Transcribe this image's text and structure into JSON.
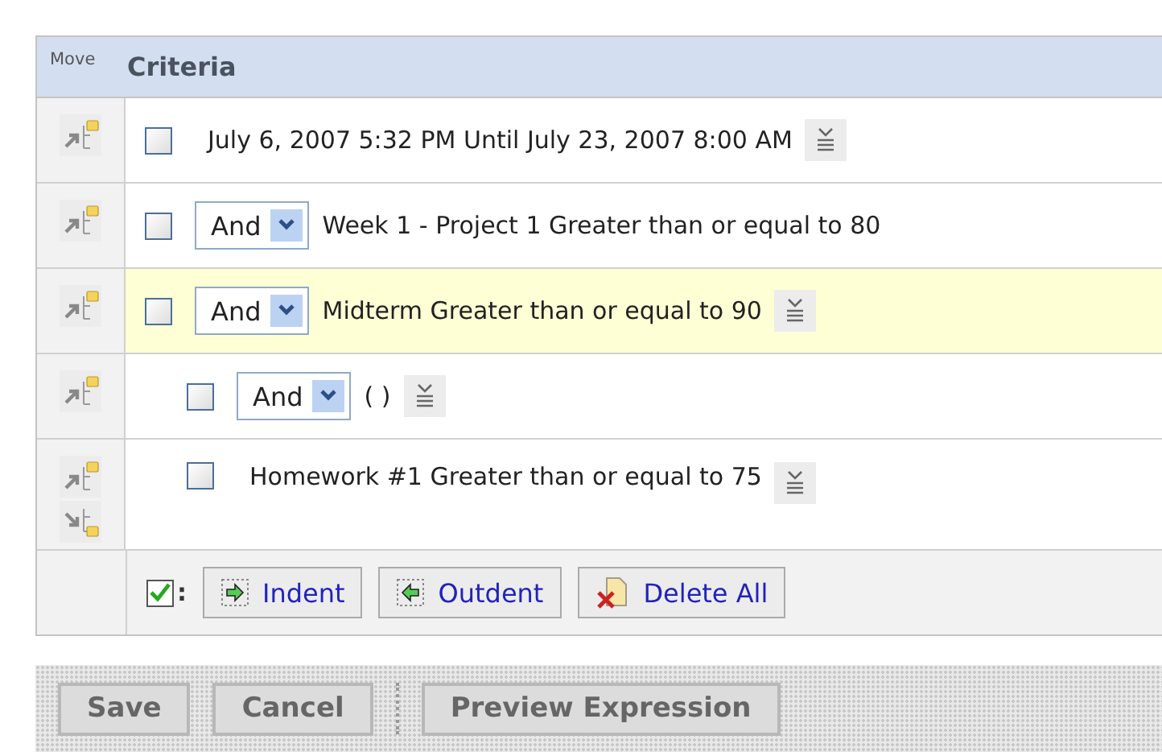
{
  "header": {
    "move": "Move",
    "criteria": "Criteria"
  },
  "criteria": [
    {
      "checked": false,
      "text": "July 6, 2007 5:32 PM Until July 23, 2007 8:00 AM",
      "menu": true,
      "highlighted": false,
      "move_down": false
    },
    {
      "checked": false,
      "operator": "And",
      "text": "Week 1 - Project 1 Greater than or equal to 80",
      "menu": false,
      "highlighted": false,
      "move_down": false
    },
    {
      "checked": false,
      "operator": "And",
      "text": "Midterm Greater than or equal to 90",
      "menu": true,
      "highlighted": true,
      "move_down": false,
      "children": [
        {
          "checked": false,
          "operator": "And",
          "text": "( )",
          "menu": true,
          "highlighted": false,
          "move_down": false
        },
        {
          "checked": false,
          "text": "Homework #1 Greater than or equal to 75",
          "menu": true,
          "highlighted": false,
          "move_down": true
        }
      ]
    }
  ],
  "toolbar": {
    "checked": true,
    "colon": ":",
    "buttons": [
      {
        "label": "Indent",
        "kind": "indent"
      },
      {
        "label": "Outdent",
        "kind": "outdent"
      },
      {
        "label": "Delete All",
        "kind": "delete"
      }
    ]
  },
  "footer": [
    {
      "label": "Save",
      "kind": "button"
    },
    {
      "label": "Cancel",
      "kind": "button"
    },
    {
      "kind": "separator"
    },
    {
      "label": "Preview Expression",
      "kind": "button"
    }
  ]
}
